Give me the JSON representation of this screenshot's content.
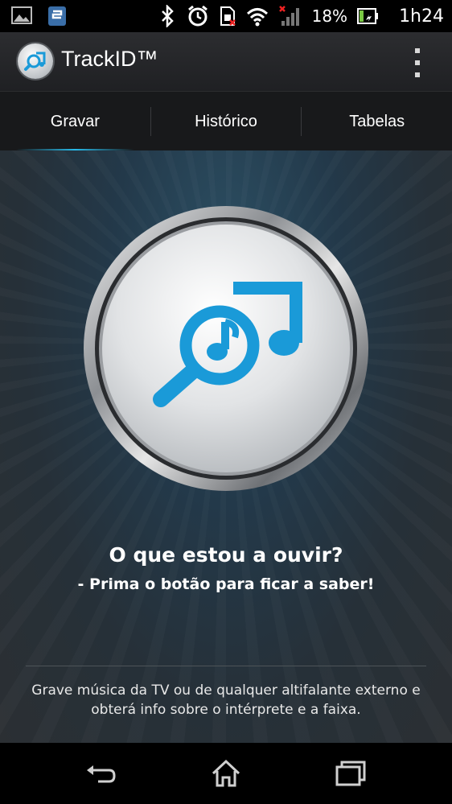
{
  "status_bar": {
    "battery_percent": "18%",
    "time": "1h24",
    "icons": [
      "gallery-icon",
      "app-notification-icon",
      "bluetooth-icon",
      "alarm-icon",
      "sim-icon",
      "wifi-icon",
      "signal-icon",
      "battery-icon"
    ]
  },
  "action_bar": {
    "title": "TrackID™",
    "overflow_icon": "overflow-menu-icon"
  },
  "tabs": [
    {
      "label": "Gravar",
      "selected": true
    },
    {
      "label": "Histórico",
      "selected": false
    },
    {
      "label": "Tabelas",
      "selected": false
    }
  ],
  "main": {
    "record_button_icon": "trackid-search-note-icon",
    "question": "O que estou a ouvir?",
    "subtext": "- Prima o botão para ficar a saber!",
    "description": "Grave música da TV ou de qualquer altifalante externo e obterá info sobre o intérprete e a faixa."
  },
  "colors": {
    "accent": "#1a9ad8",
    "tab_indicator": "#28b9e8",
    "background": "#263038"
  },
  "nav_bar": {
    "buttons": [
      "back-icon",
      "home-icon",
      "recent-apps-icon"
    ]
  }
}
